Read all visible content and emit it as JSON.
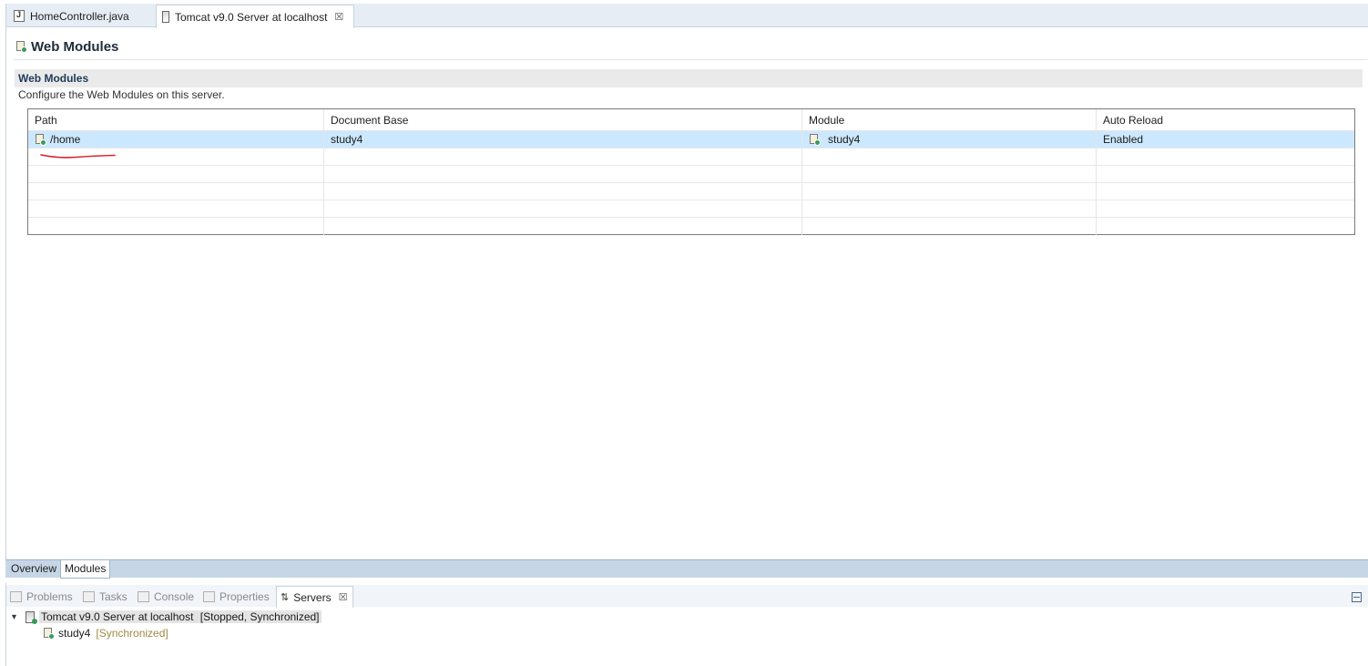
{
  "editor": {
    "tabs": [
      {
        "label": "HomeController.java",
        "icon": "java-file-icon"
      },
      {
        "label": "Tomcat v9.0 Server at localhost",
        "icon": "server-file-icon",
        "close": "☒"
      }
    ],
    "form_title": "Web Modules",
    "section": {
      "title": "Web Modules",
      "description": "Configure the Web Modules on this server."
    },
    "table": {
      "columns": [
        "Path",
        "Document Base",
        "Module",
        "Auto Reload"
      ],
      "rows": [
        {
          "path": "/home",
          "document_base": "study4",
          "module": "study4",
          "auto_reload": "Enabled"
        }
      ]
    },
    "page_tabs": [
      "Overview",
      "Modules"
    ],
    "annotation_color": "#d9202c"
  },
  "views": {
    "tabs": [
      "Problems",
      "Tasks",
      "Console",
      "Properties",
      "Servers"
    ],
    "active_tab": "Servers",
    "close": "☒",
    "server": {
      "label": "Tomcat v9.0 Server at localhost",
      "state": "[Stopped, Synchronized]",
      "children": [
        {
          "label": "study4",
          "state": "[Synchronized]"
        }
      ]
    }
  }
}
